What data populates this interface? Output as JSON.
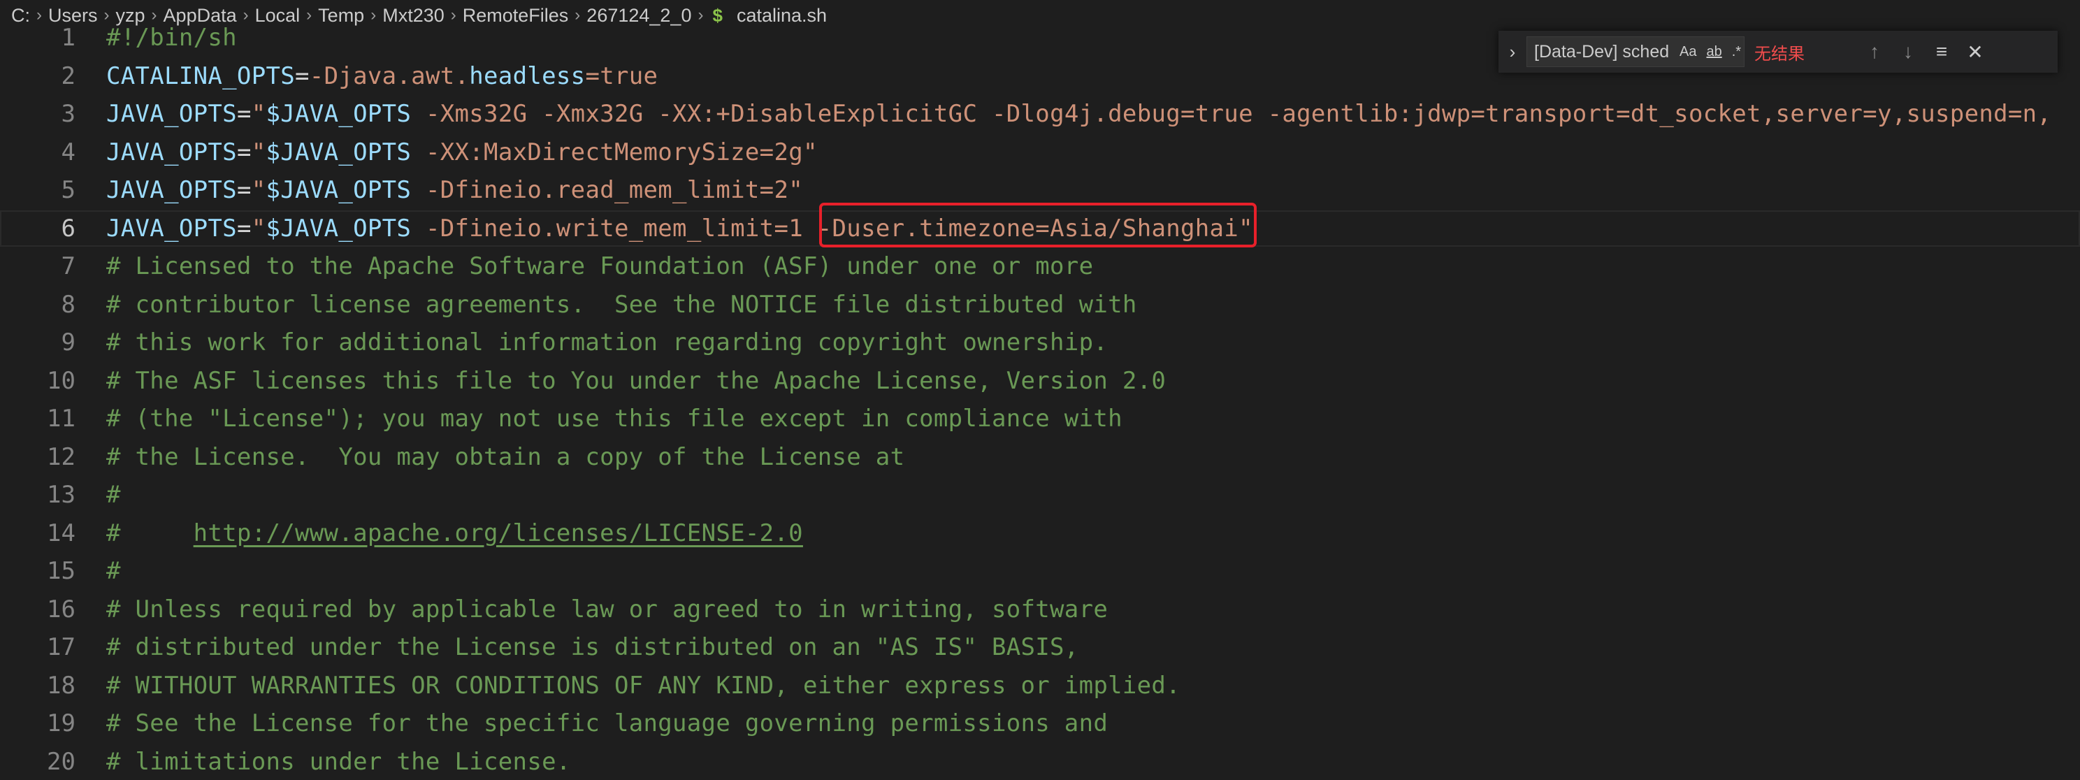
{
  "breadcrumb": {
    "segments": [
      "C:",
      "Users",
      "yzp",
      "AppData",
      "Local",
      "Temp",
      "Mxt230",
      "RemoteFiles",
      "267124_2_0"
    ],
    "file_icon": "$",
    "file_name": "catalina.sh"
  },
  "find_widget": {
    "query": "[Data-Dev] schedule j",
    "match_case_label": "Aa",
    "whole_word_label": "ab",
    "regex_label": ".*",
    "result_text": "无结果",
    "icons": [
      "chevron-right-icon",
      "arrow-up-icon",
      "arrow-down-icon",
      "find-in-selection-icon",
      "close-icon"
    ]
  },
  "editor": {
    "active_line": 6,
    "lines": [
      {
        "n": "1",
        "parts": [
          {
            "t": "#!/bin/sh",
            "k": "c"
          }
        ]
      },
      {
        "n": "2",
        "parts": [
          {
            "t": "CATALINA_OPTS",
            "k": "v"
          },
          {
            "t": "=",
            "k": "o"
          },
          {
            "t": "-Djava.awt.",
            "k": "s"
          },
          {
            "t": "headless",
            "k": "v"
          },
          {
            "t": "=true",
            "k": "s"
          }
        ]
      },
      {
        "n": "3",
        "parts": [
          {
            "t": "JAVA_OPTS",
            "k": "v"
          },
          {
            "t": "=",
            "k": "o"
          },
          {
            "t": "\"",
            "k": "s"
          },
          {
            "t": "$JAVA_OPTS",
            "k": "v"
          },
          {
            "t": " -Xms32G -Xmx32G -XX:+DisableExplicitGC -Dlog4j.debug=true -agentlib:jdwp=transport=dt_socket,server=y,suspend=n,",
            "k": "s"
          }
        ]
      },
      {
        "n": "4",
        "parts": [
          {
            "t": "JAVA_OPTS",
            "k": "v"
          },
          {
            "t": "=",
            "k": "o"
          },
          {
            "t": "\"",
            "k": "s"
          },
          {
            "t": "$JAVA_OPTS",
            "k": "v"
          },
          {
            "t": " -XX:MaxDirectMemorySize=2g\"",
            "k": "s"
          }
        ]
      },
      {
        "n": "5",
        "parts": [
          {
            "t": "JAVA_OPTS",
            "k": "v"
          },
          {
            "t": "=",
            "k": "o"
          },
          {
            "t": "\"",
            "k": "s"
          },
          {
            "t": "$JAVA_OPTS",
            "k": "v"
          },
          {
            "t": " -Dfineio.read_mem_limit=2\"",
            "k": "s"
          }
        ]
      },
      {
        "n": "6",
        "parts": [
          {
            "t": "JAVA_OPTS",
            "k": "v"
          },
          {
            "t": "=",
            "k": "o"
          },
          {
            "t": "\"",
            "k": "s"
          },
          {
            "t": "$JAVA_OPTS",
            "k": "v"
          },
          {
            "t": " -Dfineio.write_mem_limit=1 -Duser.timezone=Asia/Shanghai\"",
            "k": "s"
          }
        ]
      },
      {
        "n": "7",
        "parts": [
          {
            "t": "# Licensed to the Apache Software Foundation (ASF) under one or more",
            "k": "c"
          }
        ]
      },
      {
        "n": "8",
        "parts": [
          {
            "t": "# contributor license agreements.  See the NOTICE file distributed with",
            "k": "c"
          }
        ]
      },
      {
        "n": "9",
        "parts": [
          {
            "t": "# this work for additional information regarding copyright ownership.",
            "k": "c"
          }
        ]
      },
      {
        "n": "10",
        "parts": [
          {
            "t": "# The ASF licenses this file to You under the Apache License, Version 2.0",
            "k": "c"
          }
        ]
      },
      {
        "n": "11",
        "parts": [
          {
            "t": "# (the \"License\"); you may not use this file except in compliance with",
            "k": "c"
          }
        ]
      },
      {
        "n": "12",
        "parts": [
          {
            "t": "# the License.  You may obtain a copy of the License at",
            "k": "c"
          }
        ]
      },
      {
        "n": "13",
        "parts": [
          {
            "t": "#",
            "k": "c"
          }
        ]
      },
      {
        "n": "14",
        "parts": [
          {
            "t": "#     ",
            "k": "c"
          },
          {
            "t": "http://www.apache.org/licenses/LICENSE-2.0",
            "k": "u"
          }
        ]
      },
      {
        "n": "15",
        "parts": [
          {
            "t": "#",
            "k": "c"
          }
        ]
      },
      {
        "n": "16",
        "parts": [
          {
            "t": "# Unless required by applicable law or agreed to in writing, software",
            "k": "c"
          }
        ]
      },
      {
        "n": "17",
        "parts": [
          {
            "t": "# distributed under the License is distributed on an \"AS IS\" BASIS,",
            "k": "c"
          }
        ]
      },
      {
        "n": "18",
        "parts": [
          {
            "t": "# WITHOUT WARRANTIES OR CONDITIONS OF ANY KIND, either express or implied.",
            "k": "c"
          }
        ]
      },
      {
        "n": "19",
        "parts": [
          {
            "t": "# See the License for the specific language governing permissions and",
            "k": "c"
          }
        ]
      },
      {
        "n": "20",
        "parts": [
          {
            "t": "# limitations under the License.",
            "k": "c"
          }
        ]
      }
    ]
  },
  "colors": {
    "background": "#1e1e1e",
    "variable": "#9cdcfe",
    "string": "#ce9178",
    "comment": "#6a9955",
    "highlight_box": "#e8202a",
    "no_result": "#f14c4c"
  }
}
